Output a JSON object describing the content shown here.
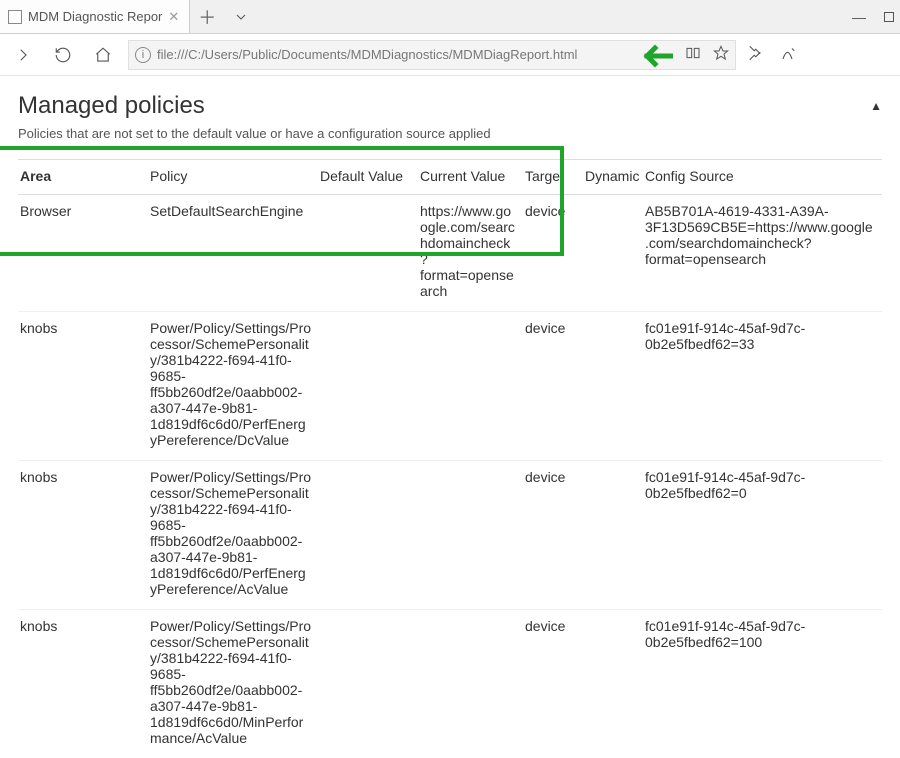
{
  "window": {
    "tab_title": "MDM Diagnostic Repor"
  },
  "address": {
    "url": "file:///C:/Users/Public/Documents/MDMDiagnostics/MDMDiagReport.html"
  },
  "section": {
    "title": "Managed policies",
    "subtitle": "Policies that are not set to the default value or have a configuration source applied"
  },
  "headers": {
    "area": "Area",
    "policy": "Policy",
    "default_value": "Default Value",
    "current_value": "Current Value",
    "target": "Target",
    "dynamic": "Dynamic",
    "config_source": "Config Source"
  },
  "rows": [
    {
      "area": "Browser",
      "policy": "SetDefaultSearchEngine",
      "default_value": "",
      "current_value": "https://www.google.com/searchdomaincheck?format=opensearch",
      "target": "device",
      "dynamic": "",
      "config_source": "AB5B701A-4619-4331-A39A-3F13D569CB5E=https://www.google.com/searchdomaincheck?format=opensearch"
    },
    {
      "area": "knobs",
      "policy": "Power/Policy/Settings/Processor/SchemePersonality/381b4222-f694-41f0-9685-ff5bb260df2e/0aabb002-a307-447e-9b81-1d819df6c6d0/PerfEnergyPereference/DcValue",
      "default_value": "",
      "current_value": "",
      "target": "device",
      "dynamic": "",
      "config_source": "fc01e91f-914c-45af-9d7c-0b2e5fbedf62=33"
    },
    {
      "area": "knobs",
      "policy": "Power/Policy/Settings/Processor/SchemePersonality/381b4222-f694-41f0-9685-ff5bb260df2e/0aabb002-a307-447e-9b81-1d819df6c6d0/PerfEnergyPereference/AcValue",
      "default_value": "",
      "current_value": "",
      "target": "device",
      "dynamic": "",
      "config_source": "fc01e91f-914c-45af-9d7c-0b2e5fbedf62=0"
    },
    {
      "area": "knobs",
      "policy": "Power/Policy/Settings/Processor/SchemePersonality/381b4222-f694-41f0-9685-ff5bb260df2e/0aabb002-a307-447e-9b81-1d819df6c6d0/MinPerformance/AcValue",
      "default_value": "",
      "current_value": "",
      "target": "device",
      "dynamic": "",
      "config_source": "fc01e91f-914c-45af-9d7c-0b2e5fbedf62=100"
    }
  ]
}
